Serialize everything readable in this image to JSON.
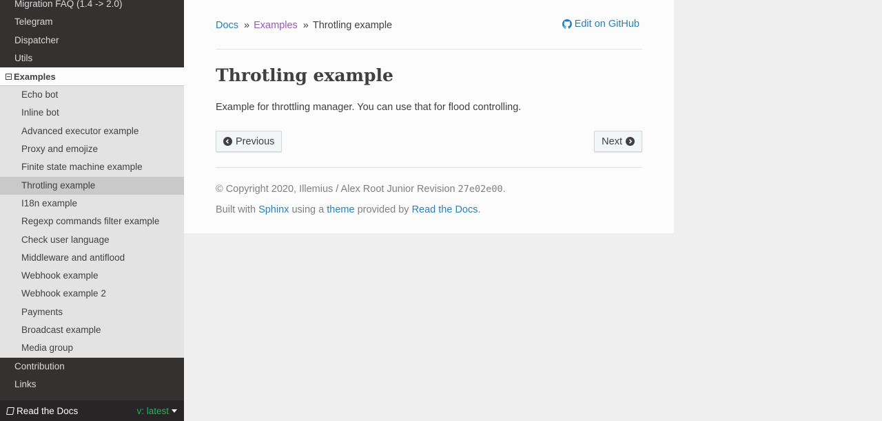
{
  "sidebar": {
    "top_items": [
      "Migration FAQ (1.4 -> 2.0)",
      "Telegram",
      "Dispatcher",
      "Utils"
    ],
    "current_section": "Examples",
    "sub_items": [
      "Echo bot",
      "Inline bot",
      "Advanced executor example",
      "Proxy and emojize",
      "Finite state machine example",
      "Throtling example",
      "I18n example",
      "Regexp commands filter example",
      "Check user language",
      "Middleware and antiflood",
      "Webhook example",
      "Webhook example 2",
      "Payments",
      "Broadcast example",
      "Media group"
    ],
    "bottom_items": [
      "Contribution",
      "Links"
    ]
  },
  "rtd": {
    "label": "Read the Docs",
    "version": "v: latest"
  },
  "breadcrumb": {
    "docs": "Docs",
    "sep1": "»",
    "examples": "Examples",
    "sep2": "»",
    "current": "Throtling example",
    "edit": "Edit on GitHub"
  },
  "page": {
    "title": "Throtling example",
    "lead": "Example for throttling manager. You can use that for flood controlling."
  },
  "nav": {
    "previous": "Previous",
    "next": "Next"
  },
  "footer": {
    "copyright": "© Copyright 2020, Illemius / Alex Root Junior Revision",
    "revision": "27e02e00",
    "period": ".",
    "built_with": "Built with",
    "sphinx": "Sphinx",
    "using_a": "using a",
    "theme": "theme",
    "provided_by": "provided by",
    "rtd": "Read the Docs",
    "end": "."
  },
  "colors": {
    "sidebar_bg": "#343131",
    "link": "#2980b9",
    "visited": "#9b59b6",
    "version": "#27ae60"
  }
}
